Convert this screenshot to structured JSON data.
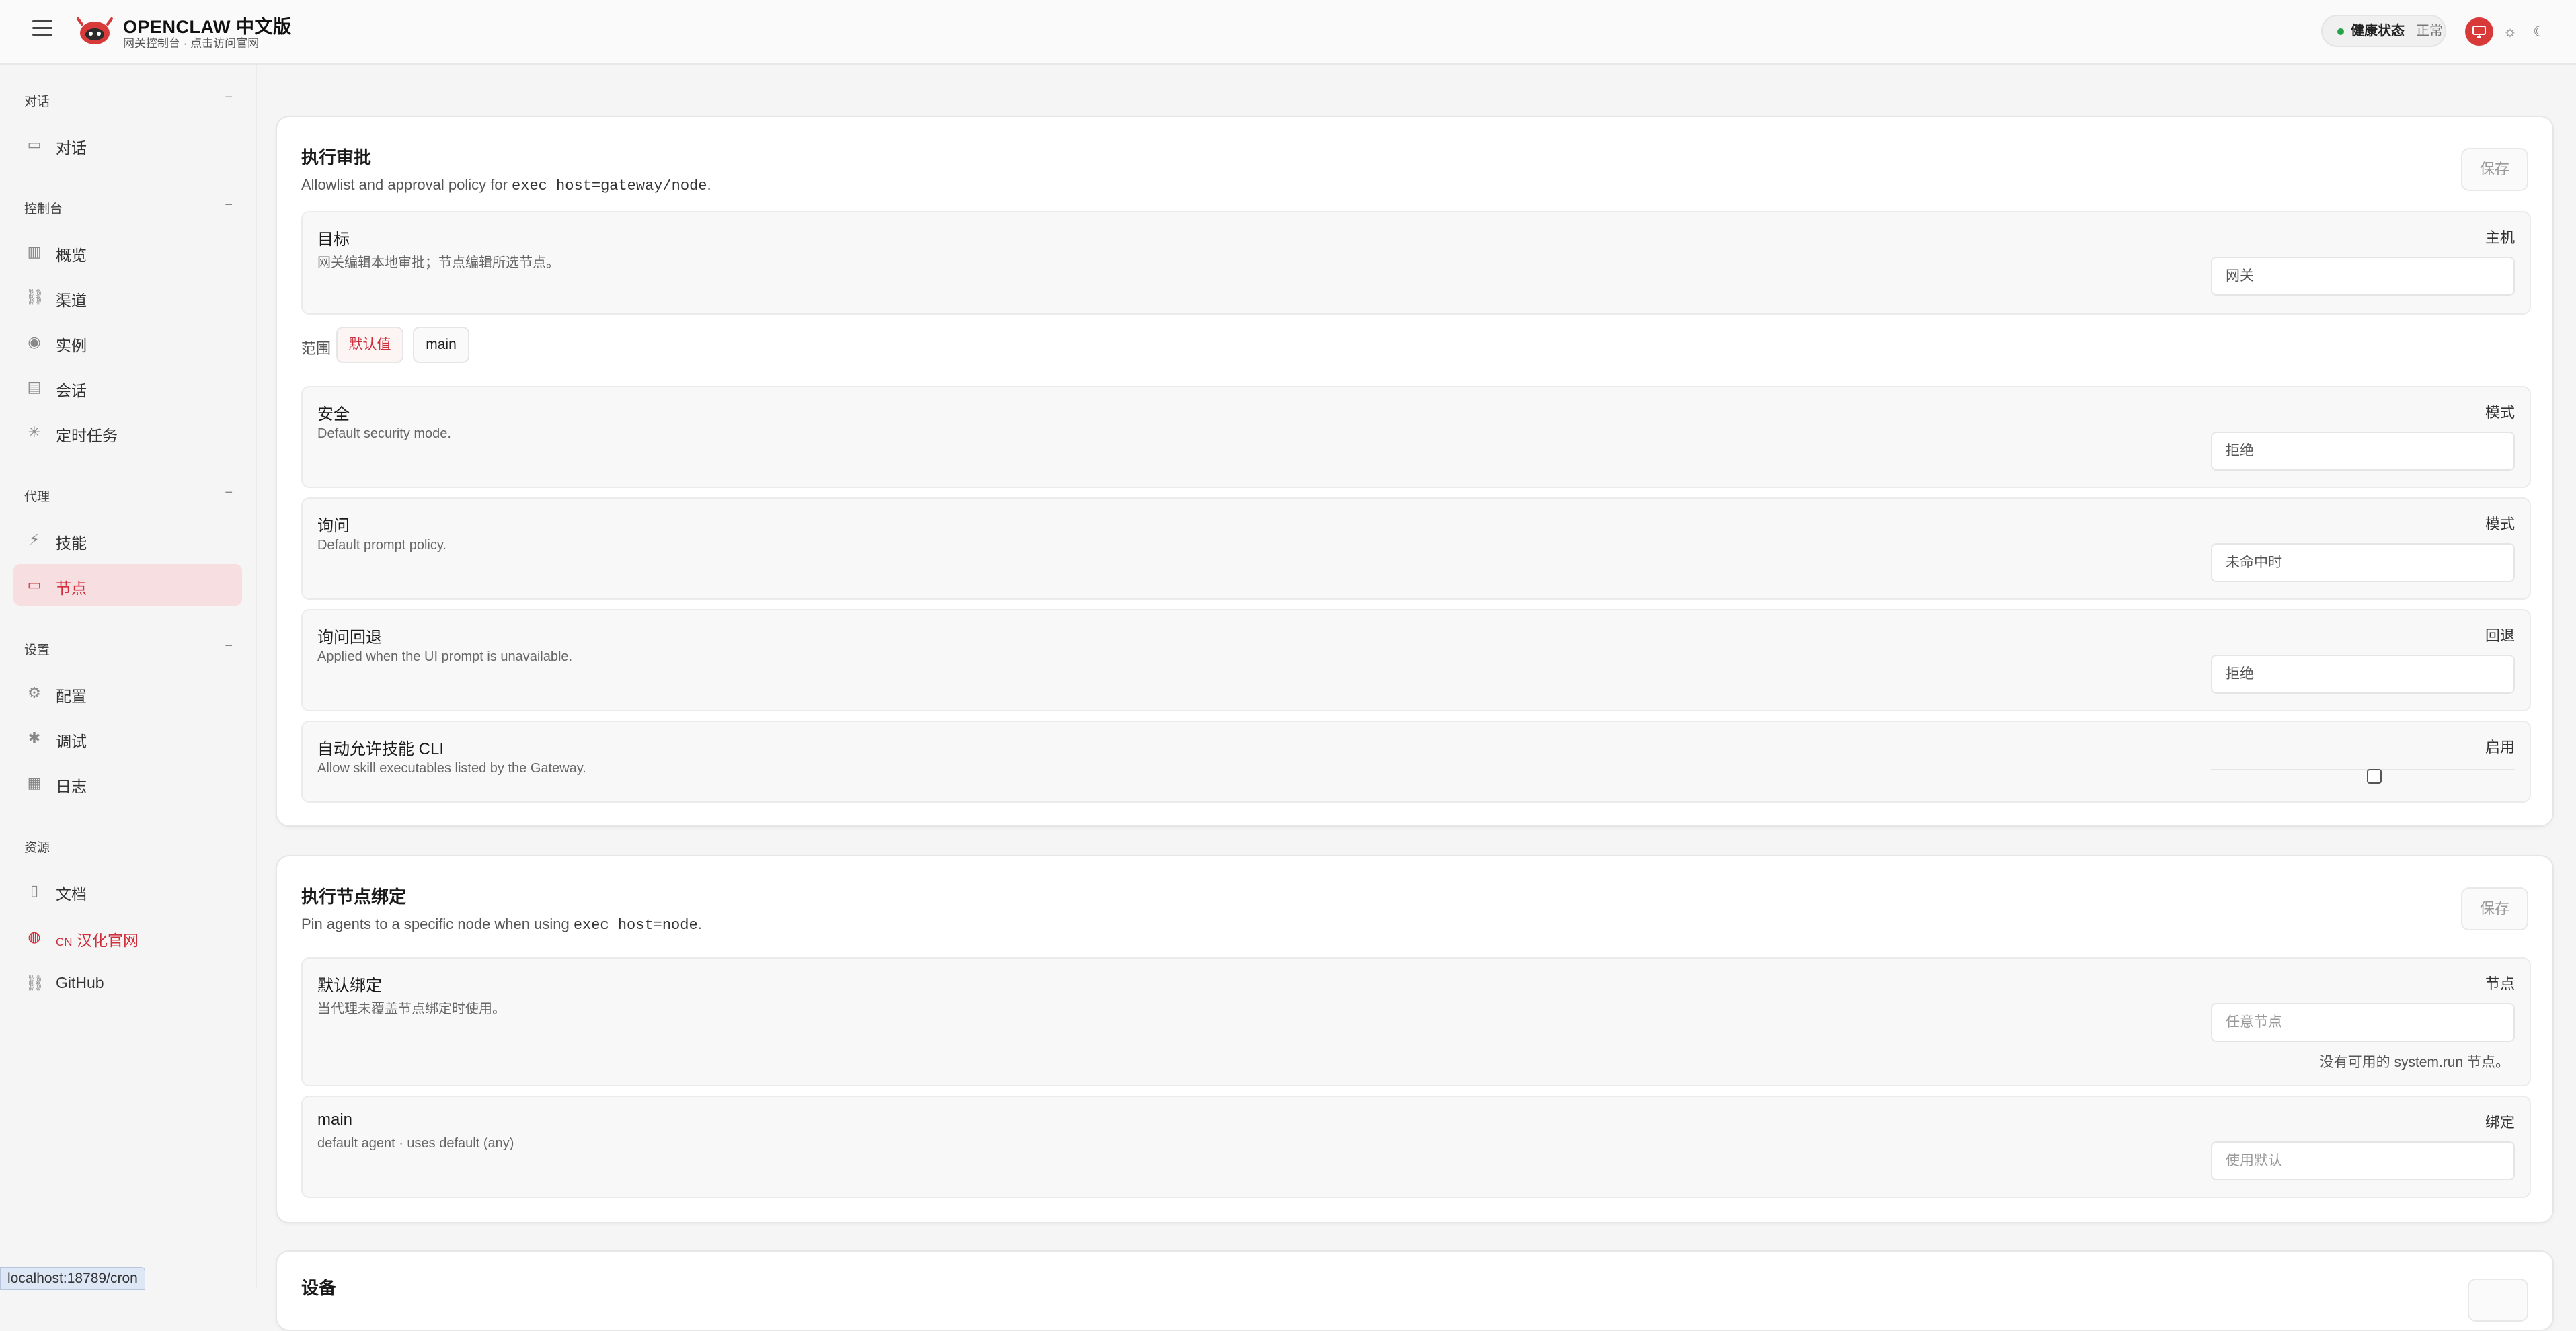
{
  "header": {
    "brand_title": "OPENCLAW 中文版",
    "brand_subtitle": "网关控制台 · 点击访问官网",
    "health_label": "健康状态",
    "health_value": "正常"
  },
  "sidebar": {
    "sections": [
      {
        "title": "对话",
        "items": [
          {
            "label": "对话",
            "icon": "chat-icon"
          }
        ]
      },
      {
        "title": "控制台",
        "items": [
          {
            "label": "概览",
            "icon": "bar-chart-icon"
          },
          {
            "label": "渠道",
            "icon": "link-icon"
          },
          {
            "label": "实例",
            "icon": "broadcast-icon"
          },
          {
            "label": "会话",
            "icon": "document-icon"
          },
          {
            "label": "定时任务",
            "icon": "loader-icon"
          }
        ]
      },
      {
        "title": "代理",
        "items": [
          {
            "label": "技能",
            "icon": "lightning-icon"
          },
          {
            "label": "节点",
            "icon": "monitor-icon"
          }
        ]
      },
      {
        "title": "设置",
        "items": [
          {
            "label": "配置",
            "icon": "gear-icon"
          },
          {
            "label": "调试",
            "icon": "bug-icon"
          },
          {
            "label": "日志",
            "icon": "log-icon"
          }
        ]
      },
      {
        "title": "资源",
        "items": [
          {
            "label": "文档",
            "icon": "book-icon"
          },
          {
            "label": "汉化官网",
            "prefix": "CN",
            "icon": "globe-icon"
          },
          {
            "label": "GitHub",
            "icon": "link-icon"
          }
        ]
      }
    ],
    "active_item": "节点"
  },
  "status_url": "localhost:18789/cron",
  "exec_approval": {
    "title": "执行审批",
    "desc_prefix": "Allowlist and approval policy for ",
    "desc_code": "exec host=gateway/node",
    "desc_suffix": ".",
    "save_label": "保存",
    "target": {
      "title": "目标",
      "desc": "网关编辑本地审批；节点编辑所选节点。",
      "label": "主机",
      "value": "网关"
    },
    "scope_label": "范围",
    "scope_chips": [
      "默认值",
      "main"
    ],
    "security": {
      "title": "安全",
      "desc": "Default security mode.",
      "label": "模式",
      "value": "拒绝"
    },
    "ask": {
      "title": "询问",
      "desc": "Default prompt policy.",
      "label": "模式",
      "value": "未命中时"
    },
    "ask_fallback": {
      "title": "询问回退",
      "desc": "Applied when the UI prompt is unavailable.",
      "label": "回退",
      "value": "拒绝"
    },
    "auto_allow": {
      "title": "自动允许技能 CLI",
      "desc": "Allow skill executables listed by the Gateway.",
      "label": "启用",
      "checked": false
    }
  },
  "exec_binding": {
    "title": "执行节点绑定",
    "desc_prefix": "Pin agents to a specific node when using ",
    "desc_code": "exec host=node",
    "desc_suffix": ".",
    "save_label": "保存",
    "default_binding": {
      "title": "默认绑定",
      "desc": "当代理未覆盖节点绑定时使用。",
      "label": "节点",
      "placeholder": "任意节点",
      "note": "没有可用的 system.run 节点。"
    },
    "main_binding": {
      "title": "main",
      "desc": "default agent · uses default (any)",
      "label": "绑定",
      "placeholder": "使用默认"
    }
  },
  "devices": {
    "title": "设备"
  },
  "colors": {
    "accent": "#cf2e3a",
    "active_bg": "#f7dfe1",
    "health_dot": "#22a447"
  }
}
